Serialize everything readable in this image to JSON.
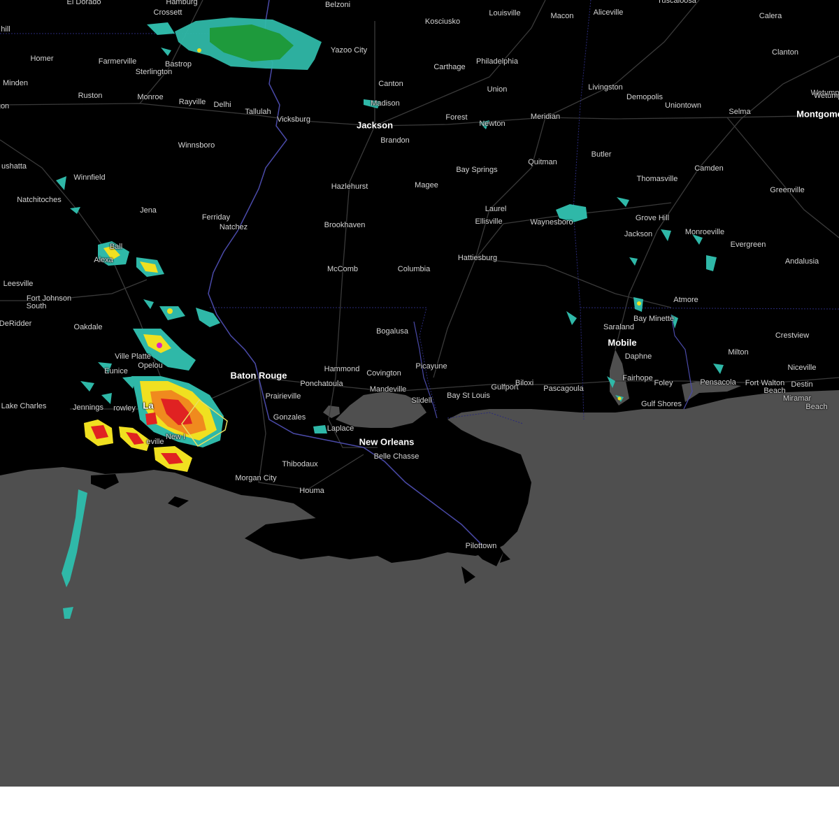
{
  "map": {
    "colors": {
      "land": "#000000",
      "water": "#4f4f4f",
      "roads": "#3a3a3a",
      "state_lines": "#2a2a7a",
      "river": "#4a4aa8",
      "warning_polygon": "#e8e060",
      "radar_light": "#2fb8a8",
      "radar_green": "#1e9a3c",
      "radar_yellow": "#f0e020",
      "radar_orange": "#f08a1e",
      "radar_red": "#e02222",
      "radar_magenta": "#e020c0",
      "footer": "#ffffff"
    },
    "cities": [
      {
        "name": "El Dorado"
      },
      {
        "name": "Hamburg"
      },
      {
        "name": "Crossett"
      },
      {
        "name": "Belzoni"
      },
      {
        "name": "Kosciusko"
      },
      {
        "name": "Louisville"
      },
      {
        "name": "Macon"
      },
      {
        "name": "Aliceville"
      },
      {
        "name": "Tuscaloosa"
      },
      {
        "name": "Calera"
      },
      {
        "name": "Clanton"
      },
      {
        "name": "Wetumpka"
      },
      {
        "name": "Homer"
      },
      {
        "name": "Farmerville"
      },
      {
        "name": "Bastrop"
      },
      {
        "name": "Sterlington"
      },
      {
        "name": "Yazoo City"
      },
      {
        "name": "Carthage"
      },
      {
        "name": "Philadelphia"
      },
      {
        "name": "Minden"
      },
      {
        "name": "Ruston"
      },
      {
        "name": "Monroe"
      },
      {
        "name": "Rayville"
      },
      {
        "name": "Delhi"
      },
      {
        "name": "Tallulah"
      },
      {
        "name": "Canton"
      },
      {
        "name": "Madison"
      },
      {
        "name": "Union"
      },
      {
        "name": "Livingston"
      },
      {
        "name": "Demopolis"
      },
      {
        "name": "Uniontown"
      },
      {
        "name": "Selma"
      },
      {
        "name": "Montgomery"
      },
      {
        "name": "Vicksburg"
      },
      {
        "name": "Jackson"
      },
      {
        "name": "Forest"
      },
      {
        "name": "Newton"
      },
      {
        "name": "Meridian"
      },
      {
        "name": "Brandon"
      },
      {
        "name": "Winnsboro"
      },
      {
        "name": "Natchitoches"
      },
      {
        "name": "Winnfield"
      },
      {
        "name": "Bay Springs"
      },
      {
        "name": "Quitman"
      },
      {
        "name": "Butler"
      },
      {
        "name": "Camden"
      },
      {
        "name": "Thomasville"
      },
      {
        "name": "Greenville"
      },
      {
        "name": "Hazlehurst"
      },
      {
        "name": "Magee"
      },
      {
        "name": "Laurel"
      },
      {
        "name": "Jena"
      },
      {
        "name": "Ferriday"
      },
      {
        "name": "Natchez"
      },
      {
        "name": "Brookhaven"
      },
      {
        "name": "Ellisville"
      },
      {
        "name": "Waynesboro"
      },
      {
        "name": "Grove Hill"
      },
      {
        "name": "Jackson"
      },
      {
        "name": "Monroeville"
      },
      {
        "name": "Evergreen"
      },
      {
        "name": "Ball"
      },
      {
        "name": "Alexandria"
      },
      {
        "name": "Leesville"
      },
      {
        "name": "Fort Johnson South"
      },
      {
        "name": "McComb"
      },
      {
        "name": "Columbia"
      },
      {
        "name": "Hattiesburg"
      },
      {
        "name": "Andalusia"
      },
      {
        "name": "DeRidder"
      },
      {
        "name": "Oakdale"
      },
      {
        "name": "Atmore"
      },
      {
        "name": "Bay Minette"
      },
      {
        "name": "Bogalusa"
      },
      {
        "name": "Saraland"
      },
      {
        "name": "Crestview"
      },
      {
        "name": "Mobile"
      },
      {
        "name": "Ville Platte"
      },
      {
        "name": "Opelousas"
      },
      {
        "name": "Eunice"
      },
      {
        "name": "Baton Rouge"
      },
      {
        "name": "Hammond"
      },
      {
        "name": "Covington"
      },
      {
        "name": "Picayune"
      },
      {
        "name": "Daphne"
      },
      {
        "name": "Milton"
      },
      {
        "name": "Niceville"
      },
      {
        "name": "Ponchatoula"
      },
      {
        "name": "Mandeville"
      },
      {
        "name": "Prairieville"
      },
      {
        "name": "Slidell"
      },
      {
        "name": "Bay St Louis"
      },
      {
        "name": "Gulfport"
      },
      {
        "name": "Biloxi"
      },
      {
        "name": "Pascagoula"
      },
      {
        "name": "Fairhope"
      },
      {
        "name": "Foley"
      },
      {
        "name": "Pensacola"
      },
      {
        "name": "Fort Walton Beach"
      },
      {
        "name": "Destin"
      },
      {
        "name": "Lake Charles"
      },
      {
        "name": "Jennings"
      },
      {
        "name": "Crowley"
      },
      {
        "name": "Lafayette"
      },
      {
        "name": "Gonzales"
      },
      {
        "name": "Gulf Shores"
      },
      {
        "name": "Miramar Beach"
      },
      {
        "name": "Laplace"
      },
      {
        "name": "New Iberia"
      },
      {
        "name": "Abbeville"
      },
      {
        "name": "New Orleans"
      },
      {
        "name": "Belle Chasse"
      },
      {
        "name": "Thibodaux"
      },
      {
        "name": "Morgan City"
      },
      {
        "name": "Houma"
      },
      {
        "name": "Pilottown"
      }
    ]
  },
  "labels": [
    {
      "text": "El Dorado",
      "major": false
    },
    {
      "text": "Hamburg",
      "major": false
    },
    {
      "text": "Crossett",
      "major": false
    },
    {
      "text": "Belzoni",
      "major": false
    },
    {
      "text": "Kosciusko",
      "major": false
    },
    {
      "text": "Louisville",
      "major": false
    },
    {
      "text": "Macon",
      "major": false
    },
    {
      "text": "Aliceville",
      "major": false
    },
    {
      "text": "Tuscaloosa",
      "major": false
    },
    {
      "text": "Calera",
      "major": false
    },
    {
      "text": "Clanton",
      "major": false
    },
    {
      "text": "Wetump",
      "major": false
    },
    {
      "text": "hill",
      "major": false
    },
    {
      "text": "Homer",
      "major": false
    },
    {
      "text": "Farmerville",
      "major": false
    },
    {
      "text": "Bastrop",
      "major": false
    },
    {
      "text": "Sterlington",
      "major": false
    },
    {
      "text": "Yazoo City",
      "major": false
    },
    {
      "text": "Carthage",
      "major": false
    },
    {
      "text": "Philadelphia",
      "major": false
    },
    {
      "text": "Minden",
      "major": false
    },
    {
      "text": "Ruston",
      "major": false
    },
    {
      "text": "Monroe",
      "major": false
    },
    {
      "text": "Rayville",
      "major": false
    },
    {
      "text": "Delhi",
      "major": false
    },
    {
      "text": "Tallulah",
      "major": false
    },
    {
      "text": "Canton",
      "major": false
    },
    {
      "text": "Madison",
      "major": false
    },
    {
      "text": "Union",
      "major": false
    },
    {
      "text": "Livingston",
      "major": false
    },
    {
      "text": "Demopolis",
      "major": false
    },
    {
      "text": "Uniontown",
      "major": false
    },
    {
      "text": "Selma",
      "major": false
    },
    {
      "text": "Montgome",
      "major": true
    },
    {
      "text": "Vicksburg",
      "major": false
    },
    {
      "text": "Jackson",
      "major": true
    },
    {
      "text": "Forest",
      "major": false
    },
    {
      "text": "Newton",
      "major": false
    },
    {
      "text": "Meridian",
      "major": false
    },
    {
      "text": "Brandon",
      "major": false
    },
    {
      "text": "Winnsboro",
      "major": false
    },
    {
      "text": "ushatta",
      "major": false
    },
    {
      "text": "Natchitoches",
      "major": false
    },
    {
      "text": "Winnfield",
      "major": false
    },
    {
      "text": "Bay Springs",
      "major": false
    },
    {
      "text": "Quitman",
      "major": false
    },
    {
      "text": "Butler",
      "major": false
    },
    {
      "text": "Camden",
      "major": false
    },
    {
      "text": "Thomasville",
      "major": false
    },
    {
      "text": "Greenville",
      "major": false
    },
    {
      "text": "Hazlehurst",
      "major": false
    },
    {
      "text": "Magee",
      "major": false
    },
    {
      "text": "Laurel",
      "major": false
    },
    {
      "text": "Jena",
      "major": false
    },
    {
      "text": "Ferriday",
      "major": false
    },
    {
      "text": "Natchez",
      "major": false
    },
    {
      "text": "Brookhaven",
      "major": false
    },
    {
      "text": "Ellisville",
      "major": false
    },
    {
      "text": "Waynesboro",
      "major": false
    },
    {
      "text": "Grove Hill",
      "major": false
    },
    {
      "text": "Jackson",
      "major": false
    },
    {
      "text": "Monroeville",
      "major": false
    },
    {
      "text": "Evergreen",
      "major": false
    },
    {
      "text": "Ball",
      "major": false
    },
    {
      "text": "Alexa",
      "major": false
    },
    {
      "text": "Leesville",
      "major": false
    },
    {
      "text": "Fort Johnson",
      "major": false
    },
    {
      "text": "South",
      "major": false
    },
    {
      "text": "McComb",
      "major": false
    },
    {
      "text": "Columbia",
      "major": false
    },
    {
      "text": "Hattiesburg",
      "major": false
    },
    {
      "text": "Andalusia",
      "major": false
    },
    {
      "text": "DeRidder",
      "major": false
    },
    {
      "text": "Oakdale",
      "major": false
    },
    {
      "text": "Atmore",
      "major": false
    },
    {
      "text": "Bay Minette",
      "major": false
    },
    {
      "text": "Bogalusa",
      "major": false
    },
    {
      "text": "Saraland",
      "major": false
    },
    {
      "text": "Crestview",
      "major": false
    },
    {
      "text": "Mobile",
      "major": true
    },
    {
      "text": "Ville Platte",
      "major": false
    },
    {
      "text": "Opelou",
      "major": false
    },
    {
      "text": "Eunice",
      "major": false
    },
    {
      "text": "Baton Rouge",
      "major": true
    },
    {
      "text": "Hammond",
      "major": false
    },
    {
      "text": "Covington",
      "major": false
    },
    {
      "text": "Picayune",
      "major": false
    },
    {
      "text": "Daphne",
      "major": false
    },
    {
      "text": "Milton",
      "major": false
    },
    {
      "text": "Niceville",
      "major": false
    },
    {
      "text": "Ponchatoula",
      "major": false
    },
    {
      "text": "Mandeville",
      "major": false
    },
    {
      "text": "Prairieville",
      "major": false
    },
    {
      "text": "Slidell",
      "major": false
    },
    {
      "text": "Bay St Louis",
      "major": false
    },
    {
      "text": "Gulfport",
      "major": false
    },
    {
      "text": "Biloxi",
      "major": false
    },
    {
      "text": "Pascagoula",
      "major": false
    },
    {
      "text": "Fairhope",
      "major": false
    },
    {
      "text": "Foley",
      "major": false
    },
    {
      "text": "Pensacola",
      "major": false
    },
    {
      "text": "Fort Walton",
      "major": false
    },
    {
      "text": "Beach",
      "major": false
    },
    {
      "text": "Destin",
      "major": false
    },
    {
      "text": "Lake Charles",
      "major": false
    },
    {
      "text": "Jennings",
      "major": false
    },
    {
      "text": "rowley",
      "major": false
    },
    {
      "text": "La",
      "major": true
    },
    {
      "text": "Gonzales",
      "major": false
    },
    {
      "text": "Gulf Shores",
      "major": false
    },
    {
      "text": "Miramar",
      "major": false
    },
    {
      "text": "Beach",
      "major": false
    },
    {
      "text": "Laplace",
      "major": false
    },
    {
      "text": "New I",
      "major": false
    },
    {
      "text": "eville",
      "major": false
    },
    {
      "text": "New Orleans",
      "major": true
    },
    {
      "text": "Belle Chasse",
      "major": false
    },
    {
      "text": "Thibodaux",
      "major": false
    },
    {
      "text": "Morgan City",
      "major": false
    },
    {
      "text": "Houma",
      "major": false
    },
    {
      "text": "Pilottown",
      "major": false
    },
    {
      "text": "Wetumpka",
      "major": false
    },
    {
      "text": "gon",
      "major": false
    }
  ]
}
